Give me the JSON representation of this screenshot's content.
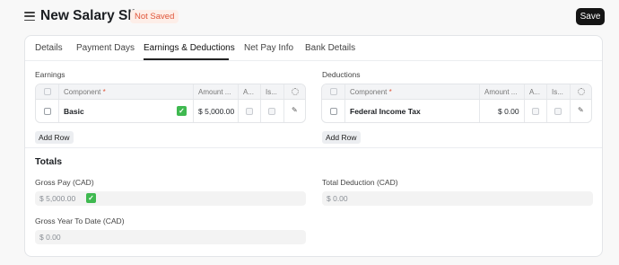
{
  "header": {
    "title": "New Salary Slip",
    "status": "Not Saved",
    "save_label": "Save"
  },
  "tabs": [
    {
      "label": "Details",
      "active": false
    },
    {
      "label": "Payment Days",
      "active": false
    },
    {
      "label": "Earnings & Deductions",
      "active": true
    },
    {
      "label": "Net Pay Info",
      "active": false
    },
    {
      "label": "Bank Details",
      "active": false
    }
  ],
  "earnings": {
    "label": "Earnings",
    "columns": {
      "component": "Component",
      "required_mark": "*",
      "amount": "Amount ...",
      "col_a": "A...",
      "col_is": "Is..."
    },
    "rows": [
      {
        "component": "Basic",
        "amount": "$ 5,000.00",
        "check_icon": "white-check-mark-emoji"
      }
    ],
    "add_row_label": "Add Row"
  },
  "deductions": {
    "label": "Deductions",
    "columns": {
      "component": "Component",
      "required_mark": "*",
      "amount": "Amount ...",
      "col_a": "A...",
      "col_is": "Is..."
    },
    "rows": [
      {
        "component": "Federal Income Tax",
        "amount": "$ 0.00"
      }
    ],
    "add_row_label": "Add Row"
  },
  "totals": {
    "title": "Totals",
    "gross_pay": {
      "label": "Gross Pay (CAD)",
      "value": "$ 5,000.00",
      "check_icon": "white-check-mark-emoji"
    },
    "total_deduction": {
      "label": "Total Deduction (CAD)",
      "value": "$ 0.00"
    },
    "gross_ytd": {
      "label": "Gross Year To Date (CAD)",
      "value": "$ 0.00"
    }
  },
  "colors": {
    "status_badge_bg": "#fdeee8",
    "status_badge_text": "#e0563a",
    "save_button_bg": "#151515",
    "check_green": "#3fb950"
  }
}
